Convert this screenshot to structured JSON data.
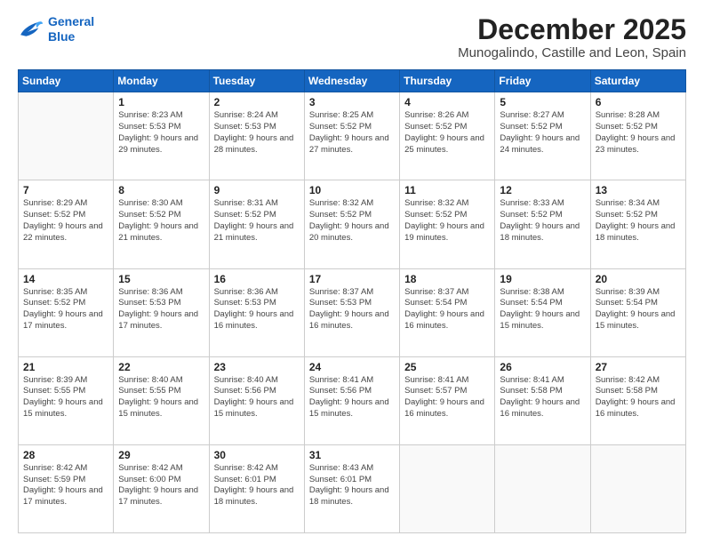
{
  "logo": {
    "line1": "General",
    "line2": "Blue"
  },
  "title": "December 2025",
  "location": "Munogalindo, Castille and Leon, Spain",
  "days_of_week": [
    "Sunday",
    "Monday",
    "Tuesday",
    "Wednesday",
    "Thursday",
    "Friday",
    "Saturday"
  ],
  "weeks": [
    [
      {
        "day": "",
        "sunrise": "",
        "sunset": "",
        "daylight": ""
      },
      {
        "day": "1",
        "sunrise": "Sunrise: 8:23 AM",
        "sunset": "Sunset: 5:53 PM",
        "daylight": "Daylight: 9 hours and 29 minutes."
      },
      {
        "day": "2",
        "sunrise": "Sunrise: 8:24 AM",
        "sunset": "Sunset: 5:53 PM",
        "daylight": "Daylight: 9 hours and 28 minutes."
      },
      {
        "day": "3",
        "sunrise": "Sunrise: 8:25 AM",
        "sunset": "Sunset: 5:52 PM",
        "daylight": "Daylight: 9 hours and 27 minutes."
      },
      {
        "day": "4",
        "sunrise": "Sunrise: 8:26 AM",
        "sunset": "Sunset: 5:52 PM",
        "daylight": "Daylight: 9 hours and 25 minutes."
      },
      {
        "day": "5",
        "sunrise": "Sunrise: 8:27 AM",
        "sunset": "Sunset: 5:52 PM",
        "daylight": "Daylight: 9 hours and 24 minutes."
      },
      {
        "day": "6",
        "sunrise": "Sunrise: 8:28 AM",
        "sunset": "Sunset: 5:52 PM",
        "daylight": "Daylight: 9 hours and 23 minutes."
      }
    ],
    [
      {
        "day": "7",
        "sunrise": "Sunrise: 8:29 AM",
        "sunset": "Sunset: 5:52 PM",
        "daylight": "Daylight: 9 hours and 22 minutes."
      },
      {
        "day": "8",
        "sunrise": "Sunrise: 8:30 AM",
        "sunset": "Sunset: 5:52 PM",
        "daylight": "Daylight: 9 hours and 21 minutes."
      },
      {
        "day": "9",
        "sunrise": "Sunrise: 8:31 AM",
        "sunset": "Sunset: 5:52 PM",
        "daylight": "Daylight: 9 hours and 21 minutes."
      },
      {
        "day": "10",
        "sunrise": "Sunrise: 8:32 AM",
        "sunset": "Sunset: 5:52 PM",
        "daylight": "Daylight: 9 hours and 20 minutes."
      },
      {
        "day": "11",
        "sunrise": "Sunrise: 8:32 AM",
        "sunset": "Sunset: 5:52 PM",
        "daylight": "Daylight: 9 hours and 19 minutes."
      },
      {
        "day": "12",
        "sunrise": "Sunrise: 8:33 AM",
        "sunset": "Sunset: 5:52 PM",
        "daylight": "Daylight: 9 hours and 18 minutes."
      },
      {
        "day": "13",
        "sunrise": "Sunrise: 8:34 AM",
        "sunset": "Sunset: 5:52 PM",
        "daylight": "Daylight: 9 hours and 18 minutes."
      }
    ],
    [
      {
        "day": "14",
        "sunrise": "Sunrise: 8:35 AM",
        "sunset": "Sunset: 5:52 PM",
        "daylight": "Daylight: 9 hours and 17 minutes."
      },
      {
        "day": "15",
        "sunrise": "Sunrise: 8:36 AM",
        "sunset": "Sunset: 5:53 PM",
        "daylight": "Daylight: 9 hours and 17 minutes."
      },
      {
        "day": "16",
        "sunrise": "Sunrise: 8:36 AM",
        "sunset": "Sunset: 5:53 PM",
        "daylight": "Daylight: 9 hours and 16 minutes."
      },
      {
        "day": "17",
        "sunrise": "Sunrise: 8:37 AM",
        "sunset": "Sunset: 5:53 PM",
        "daylight": "Daylight: 9 hours and 16 minutes."
      },
      {
        "day": "18",
        "sunrise": "Sunrise: 8:37 AM",
        "sunset": "Sunset: 5:54 PM",
        "daylight": "Daylight: 9 hours and 16 minutes."
      },
      {
        "day": "19",
        "sunrise": "Sunrise: 8:38 AM",
        "sunset": "Sunset: 5:54 PM",
        "daylight": "Daylight: 9 hours and 15 minutes."
      },
      {
        "day": "20",
        "sunrise": "Sunrise: 8:39 AM",
        "sunset": "Sunset: 5:54 PM",
        "daylight": "Daylight: 9 hours and 15 minutes."
      }
    ],
    [
      {
        "day": "21",
        "sunrise": "Sunrise: 8:39 AM",
        "sunset": "Sunset: 5:55 PM",
        "daylight": "Daylight: 9 hours and 15 minutes."
      },
      {
        "day": "22",
        "sunrise": "Sunrise: 8:40 AM",
        "sunset": "Sunset: 5:55 PM",
        "daylight": "Daylight: 9 hours and 15 minutes."
      },
      {
        "day": "23",
        "sunrise": "Sunrise: 8:40 AM",
        "sunset": "Sunset: 5:56 PM",
        "daylight": "Daylight: 9 hours and 15 minutes."
      },
      {
        "day": "24",
        "sunrise": "Sunrise: 8:41 AM",
        "sunset": "Sunset: 5:56 PM",
        "daylight": "Daylight: 9 hours and 15 minutes."
      },
      {
        "day": "25",
        "sunrise": "Sunrise: 8:41 AM",
        "sunset": "Sunset: 5:57 PM",
        "daylight": "Daylight: 9 hours and 16 minutes."
      },
      {
        "day": "26",
        "sunrise": "Sunrise: 8:41 AM",
        "sunset": "Sunset: 5:58 PM",
        "daylight": "Daylight: 9 hours and 16 minutes."
      },
      {
        "day": "27",
        "sunrise": "Sunrise: 8:42 AM",
        "sunset": "Sunset: 5:58 PM",
        "daylight": "Daylight: 9 hours and 16 minutes."
      }
    ],
    [
      {
        "day": "28",
        "sunrise": "Sunrise: 8:42 AM",
        "sunset": "Sunset: 5:59 PM",
        "daylight": "Daylight: 9 hours and 17 minutes."
      },
      {
        "day": "29",
        "sunrise": "Sunrise: 8:42 AM",
        "sunset": "Sunset: 6:00 PM",
        "daylight": "Daylight: 9 hours and 17 minutes."
      },
      {
        "day": "30",
        "sunrise": "Sunrise: 8:42 AM",
        "sunset": "Sunset: 6:01 PM",
        "daylight": "Daylight: 9 hours and 18 minutes."
      },
      {
        "day": "31",
        "sunrise": "Sunrise: 8:43 AM",
        "sunset": "Sunset: 6:01 PM",
        "daylight": "Daylight: 9 hours and 18 minutes."
      },
      {
        "day": "",
        "sunrise": "",
        "sunset": "",
        "daylight": ""
      },
      {
        "day": "",
        "sunrise": "",
        "sunset": "",
        "daylight": ""
      },
      {
        "day": "",
        "sunrise": "",
        "sunset": "",
        "daylight": ""
      }
    ]
  ]
}
